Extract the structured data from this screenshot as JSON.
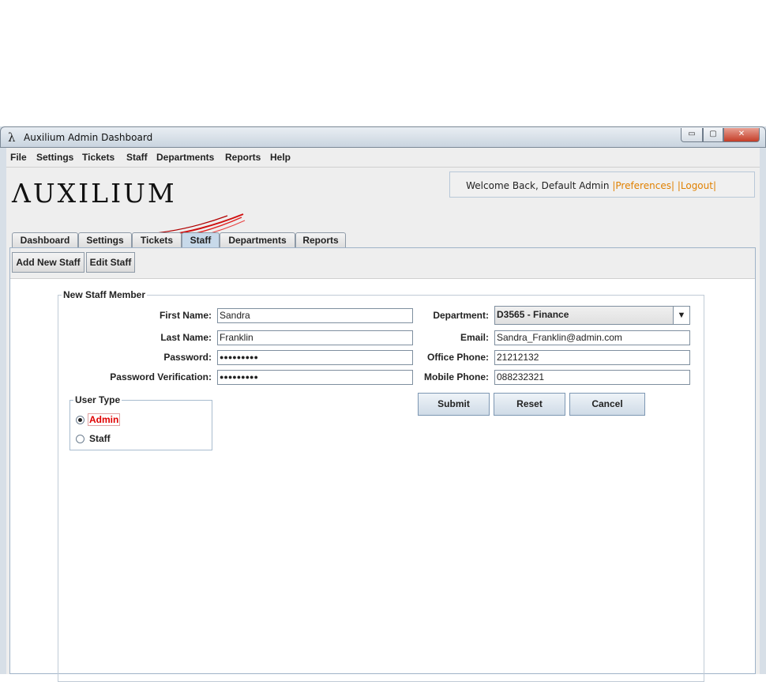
{
  "window": {
    "title": "Auxilium Admin Dashboard",
    "app_icon": "λ",
    "controls": {
      "minimize": "▭",
      "maximize": "▢",
      "close": "✕"
    }
  },
  "menubar": [
    "File",
    "Settings",
    "Tickets",
    "Staff",
    "Departments",
    "Reports",
    "Help"
  ],
  "logo": {
    "text": "ΛUXILIUM"
  },
  "welcome": {
    "text": "Welcome Back, Default Admin",
    "preferences": "|Preferences|",
    "logout": "|Logout|"
  },
  "tabs": [
    {
      "label": "Dashboard",
      "active": false
    },
    {
      "label": "Settings",
      "active": false
    },
    {
      "label": "Tickets",
      "active": false
    },
    {
      "label": "Staff",
      "active": true
    },
    {
      "label": "Departments",
      "active": false
    },
    {
      "label": "Reports",
      "active": false
    }
  ],
  "staff_actions": {
    "add": "Add New Staff",
    "edit": "Edit Staff"
  },
  "form": {
    "title": "New Staff Member",
    "first_name": {
      "label": "First Name:",
      "value": "Sandra"
    },
    "last_name": {
      "label": "Last Name:",
      "value": "Franklin"
    },
    "password": {
      "label": "Password:",
      "value": "●●●●●●●●●"
    },
    "password_verify": {
      "label": "Password Verification:",
      "value": "●●●●●●●●●"
    },
    "department": {
      "label": "Department:",
      "value": "D3565 - Finance"
    },
    "email": {
      "label": "Email:",
      "value": "Sandra_Franklin@admin.com"
    },
    "office_phone": {
      "label": "Office Phone:",
      "value": "21212132"
    },
    "mobile_phone": {
      "label": "Mobile Phone:",
      "value": "088232321"
    },
    "user_type": {
      "title": "User Type",
      "options": [
        "Admin",
        "Staff"
      ],
      "selected": "Admin"
    },
    "buttons": {
      "submit": "Submit",
      "reset": "Reset",
      "cancel": "Cancel"
    }
  },
  "colors": {
    "link": "#e08000",
    "selected_radio_label": "#e00000",
    "active_tab": "#c7d9ea"
  }
}
